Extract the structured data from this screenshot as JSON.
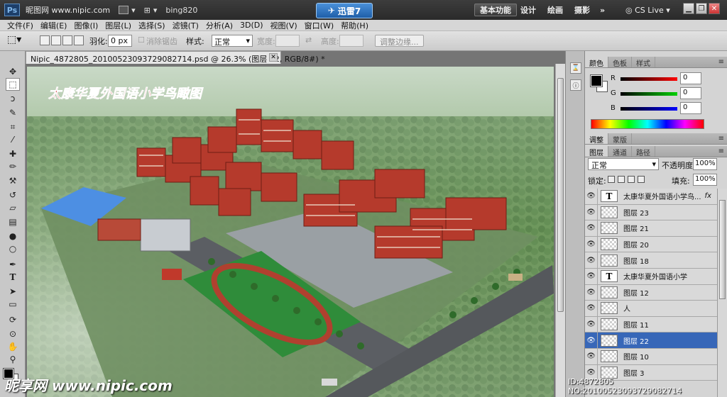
{
  "titlebar": {
    "watermark": "昵图网 www.nipic.com",
    "user": "bing820",
    "xunlei": "迅雷7",
    "workspaces": [
      "基本功能",
      "设计",
      "绘画",
      "摄影",
      "»"
    ],
    "cslive": "CS Live"
  },
  "menu": [
    "文件(F)",
    "编辑(E)",
    "图像(I)",
    "图层(L)",
    "选择(S)",
    "滤镜(T)",
    "分析(A)",
    "3D(D)",
    "视图(V)",
    "窗口(W)",
    "帮助(H)"
  ],
  "options": {
    "feather_label": "羽化:",
    "feather_value": "0 px",
    "antialias_label": "消除锯齿",
    "style_label": "样式:",
    "style_value": "正常",
    "width_label": "宽度:",
    "height_label": "高度:",
    "refine_edge": "调整边缘..."
  },
  "document": {
    "tab_title": "Nipic_4872805_20100523093729082714.psd @ 26.3% (图层 22, RGB/8#) *",
    "image_title": "太康华夏外国语小学鸟瞰图"
  },
  "color_panel": {
    "tabs": [
      "颜色",
      "色板",
      "样式"
    ],
    "channels": [
      {
        "label": "R",
        "value": "0",
        "color": "#d01010"
      },
      {
        "label": "G",
        "value": "0",
        "color": "#10b010"
      },
      {
        "label": "B",
        "value": "0",
        "color": "#1010d0"
      }
    ]
  },
  "adjust_tabs": [
    "调整",
    "蒙版"
  ],
  "layers_panel": {
    "tabs": [
      "图层",
      "通道",
      "路径"
    ],
    "blend_mode": "正常",
    "opacity_label": "不透明度:",
    "opacity_value": "100%",
    "lock_label": "锁定:",
    "fill_label": "填充:",
    "fill_value": "100%",
    "layers": [
      {
        "name": "太康华夏外国语小学鸟...",
        "type": "text",
        "fx": "fx",
        "selected": false
      },
      {
        "name": "图层 23",
        "type": "pixel",
        "fx": "",
        "selected": false
      },
      {
        "name": "图层 21",
        "type": "pixel",
        "fx": "",
        "selected": false
      },
      {
        "name": "图层 20",
        "type": "pixel",
        "fx": "",
        "selected": false
      },
      {
        "name": "图层 18",
        "type": "pixel",
        "fx": "",
        "selected": false
      },
      {
        "name": "太康华夏外国语小学",
        "type": "text",
        "fx": "",
        "selected": false
      },
      {
        "name": "图层 12",
        "type": "pixel",
        "fx": "",
        "selected": false
      },
      {
        "name": "人",
        "type": "pixel",
        "fx": "",
        "selected": false
      },
      {
        "name": "图层 11",
        "type": "pixel",
        "fx": "",
        "selected": false
      },
      {
        "name": "图层 22",
        "type": "pixel",
        "fx": "",
        "selected": true
      },
      {
        "name": "图层 10",
        "type": "pixel",
        "fx": "",
        "selected": false
      },
      {
        "name": "图层 3",
        "type": "pixel",
        "fx": "",
        "selected": false
      }
    ]
  },
  "watermark_bottom": {
    "left": "昵享网 www.nipic.com",
    "right": "ID:4872805 NO:20100523093729082714"
  }
}
